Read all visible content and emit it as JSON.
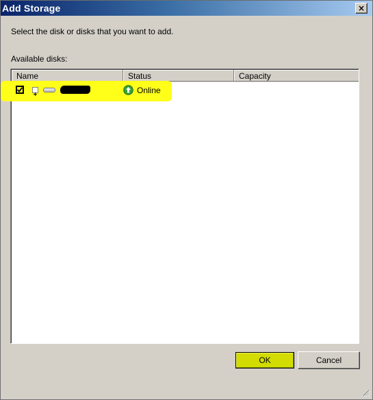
{
  "window": {
    "title": "Add Storage",
    "close_glyph": "×"
  },
  "instruction": "Select the disk or disks that you want to add.",
  "available_label": "Available disks:",
  "columns": {
    "name": "Name",
    "status": "Status",
    "capacity": "Capacity"
  },
  "disks": [
    {
      "checked": true,
      "expander_glyph": "+",
      "name": "",
      "name_redacted": true,
      "icon": "disk-icon",
      "status": "Online",
      "status_icon": "online-arrow-icon",
      "capacity": ""
    }
  ],
  "buttons": {
    "ok": "OK",
    "cancel": "Cancel"
  },
  "colors": {
    "highlight": "#ffff1a",
    "ok_button": "#d2dc00",
    "dialog_background": "#d4d0c8",
    "titlebar_start": "#0a246a",
    "status_online_green": "#3aa336"
  }
}
